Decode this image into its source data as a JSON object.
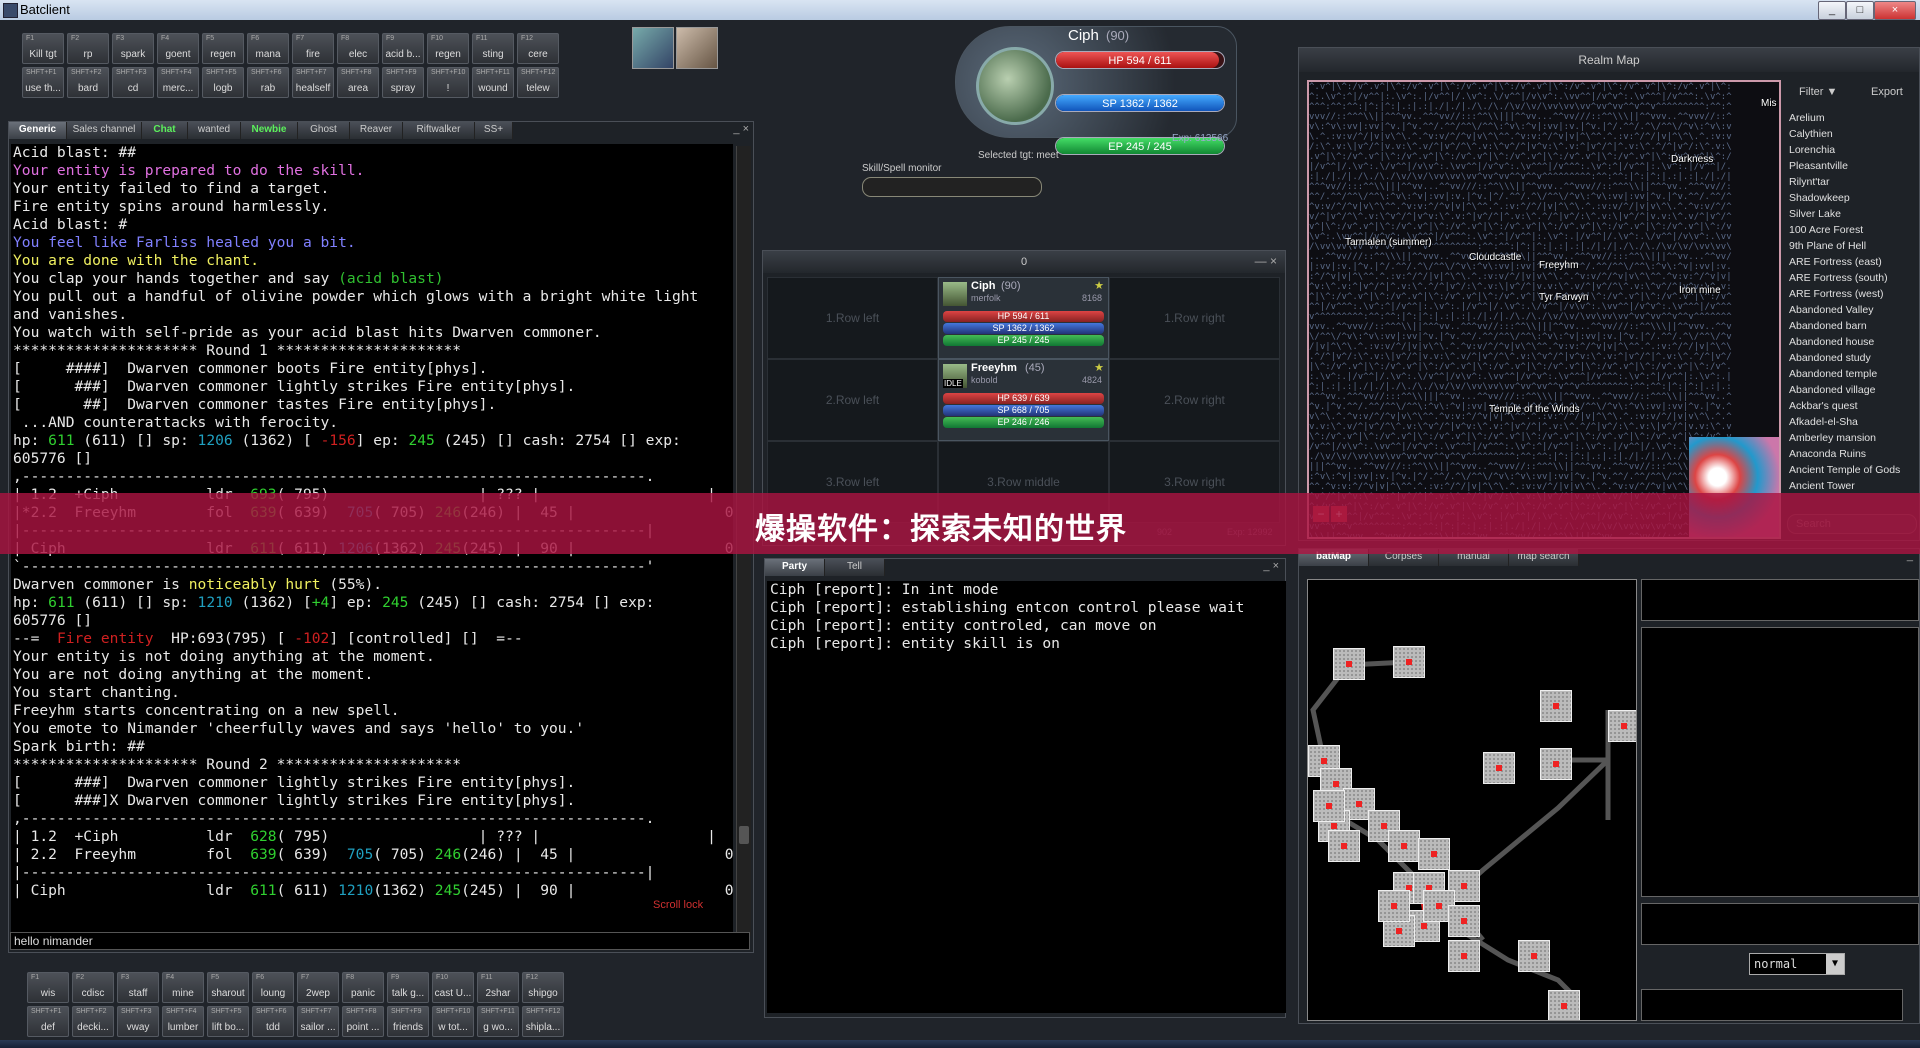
{
  "window": {
    "title": "Batclient",
    "min": "_",
    "max": "□",
    "close": "×"
  },
  "macros_top": [
    {
      "key": "F1",
      "label": "Kill tgt"
    },
    {
      "key": "F2",
      "label": "rp"
    },
    {
      "key": "F3",
      "label": "spark"
    },
    {
      "key": "F4",
      "label": "goent"
    },
    {
      "key": "F5",
      "label": "regen"
    },
    {
      "key": "F6",
      "label": "mana"
    },
    {
      "key": "F7",
      "label": "fire"
    },
    {
      "key": "F8",
      "label": "elec"
    },
    {
      "key": "F9",
      "label": "acid b..."
    },
    {
      "key": "F10",
      "label": "regen"
    },
    {
      "key": "F11",
      "label": "sting"
    },
    {
      "key": "F12",
      "label": "cere"
    },
    {
      "key": "SHFT+F1",
      "label": "use th..."
    },
    {
      "key": "SHFT+F2",
      "label": "bard"
    },
    {
      "key": "SHFT+F3",
      "label": "cd"
    },
    {
      "key": "SHFT+F4",
      "label": "merc..."
    },
    {
      "key": "SHFT+F5",
      "label": "logb"
    },
    {
      "key": "SHFT+F6",
      "label": "rab"
    },
    {
      "key": "SHFT+F7",
      "label": "healself"
    },
    {
      "key": "SHFT+F8",
      "label": "area"
    },
    {
      "key": "SHFT+F9",
      "label": "spray"
    },
    {
      "key": "SHFT+F10",
      "label": "!"
    },
    {
      "key": "SHFT+F11",
      "label": "wound"
    },
    {
      "key": "SHFT+F12",
      "label": "telew"
    }
  ],
  "macros_bottom": [
    {
      "key": "F1",
      "label": "wis"
    },
    {
      "key": "F2",
      "label": "cdisc"
    },
    {
      "key": "F3",
      "label": "staff"
    },
    {
      "key": "F4",
      "label": "mine"
    },
    {
      "key": "F5",
      "label": "sharout"
    },
    {
      "key": "F6",
      "label": "loung"
    },
    {
      "key": "F7",
      "label": "2wep"
    },
    {
      "key": "F8",
      "label": "panic"
    },
    {
      "key": "F9",
      "label": "talk g..."
    },
    {
      "key": "F10",
      "label": "cast U..."
    },
    {
      "key": "F11",
      "label": "2shar"
    },
    {
      "key": "F12",
      "label": "shipgo"
    },
    {
      "key": "SHFT+F1",
      "label": "def"
    },
    {
      "key": "SHFT+F2",
      "label": "decki..."
    },
    {
      "key": "SHFT+F3",
      "label": "vway"
    },
    {
      "key": "SHFT+F4",
      "label": "lumber"
    },
    {
      "key": "SHFT+F5",
      "label": "lift bo..."
    },
    {
      "key": "SHFT+F6",
      "label": "tdd"
    },
    {
      "key": "SHFT+F7",
      "label": "sailor ..."
    },
    {
      "key": "SHFT+F8",
      "label": "point ..."
    },
    {
      "key": "SHFT+F9",
      "label": "friends"
    },
    {
      "key": "SHFT+F10",
      "label": "w tot..."
    },
    {
      "key": "SHFT+F11",
      "label": "g wo..."
    },
    {
      "key": "SHFT+F12",
      "label": "shipla..."
    }
  ],
  "chat_tabs": [
    "Generic",
    "Sales channel",
    "Chat",
    "wanted",
    "Newbie",
    "Ghost",
    "Reaver",
    "Riftwalker",
    "SS+"
  ],
  "output_lines": [
    [
      [
        "Acid blast: ##",
        "#e8e8e8"
      ]
    ],
    [
      [
        "Your entity is prepared to do the skill.",
        "#e070e0"
      ]
    ],
    [
      [
        "Your entity failed to find a target.",
        "#e8e8e8"
      ]
    ],
    [
      [
        "Fire entity spins around harmlessly.",
        "#e8e8e8"
      ]
    ],
    [
      [
        "Acid blast: #",
        "#e8e8e8"
      ]
    ],
    [
      [
        "You feel like Farliss healed you a bit.",
        "#8080ff"
      ]
    ],
    [
      [
        "You are done with the chant.",
        "#f0f060"
      ]
    ],
    [
      [
        "You clap your hands together and say ",
        "#e8e8e8"
      ],
      [
        "(acid blast)",
        "#30c030"
      ]
    ],
    [
      [
        "You pull out a handful of olivine powder which glows with a bright white light",
        "#e8e8e8"
      ]
    ],
    [
      [
        "and vanishes.",
        "#e8e8e8"
      ]
    ],
    [
      [
        "You watch with self-pride as your acid blast hits Dwarven commoner.",
        "#e8e8e8"
      ]
    ],
    [
      [
        "********************* Round 1 *********************",
        "#e8e8e8"
      ]
    ],
    [
      [
        "[     ####]  Dwarven commoner boots Fire entity[phys].",
        "#e8e8e8"
      ]
    ],
    [
      [
        "[      ###]  Dwarven commoner lightly strikes Fire entity[phys].",
        "#e8e8e8"
      ]
    ],
    [
      [
        "[       ##]  Dwarven commoner tastes Fire entity[phys].",
        "#e8e8e8"
      ]
    ],
    [
      [
        " ...AND counterattacks with ferocity.",
        "#e8e8e8"
      ]
    ],
    [
      [
        "hp: ",
        "#e8e8e8"
      ],
      [
        "611",
        "#30d030"
      ],
      [
        " (611) [] sp: ",
        "#e8e8e8"
      ],
      [
        "1206",
        "#20a0c0"
      ],
      [
        " (1362) [ ",
        "#e8e8e8"
      ],
      [
        "-156",
        "#d02020"
      ],
      [
        "] ep: ",
        "#e8e8e8"
      ],
      [
        "245",
        "#30d030"
      ],
      [
        " (245) [] cash: 2754 [] exp:",
        "#e8e8e8"
      ]
    ],
    [
      [
        "605776 []",
        "#e8e8e8"
      ]
    ],
    [
      [
        ",-----------------------------------------------------------------------.",
        "#e8e8e8"
      ]
    ],
    [
      [
        "| 1.2  +Ciph          ldr  ",
        "#e8e8e8"
      ],
      [
        "693",
        "#30d030"
      ],
      [
        "( 795)                 | ??? |                   |",
        "#e8e8e8"
      ]
    ],
    [
      [
        "|*2.2  Freeyhm        fol  ",
        "#e8e8e8"
      ],
      [
        "639",
        "#30d030"
      ],
      [
        "( 639)  ",
        "#e8e8e8"
      ],
      [
        "705",
        "#20a0c0"
      ],
      [
        "( 705) ",
        "#e8e8e8"
      ],
      [
        "246",
        "#30d030"
      ],
      [
        "(246) |  45 |                 0 |",
        "#e8e8e8"
      ]
    ],
    [
      [
        "|-----------------------------------------------------------------------|",
        "#e8e8e8"
      ]
    ],
    [
      [
        "| Ciph                ldr  ",
        "#e8e8e8"
      ],
      [
        "611",
        "#30d030"
      ],
      [
        "( 611) ",
        "#e8e8e8"
      ],
      [
        "1206",
        "#20a0c0"
      ],
      [
        "(1362) ",
        "#e8e8e8"
      ],
      [
        "245",
        "#30d030"
      ],
      [
        "(245) |  90 |                 0 |",
        "#e8e8e8"
      ]
    ],
    [
      [
        "`-----------------------------------------------------------------------'",
        "#e8e8e8"
      ]
    ],
    [
      [
        "Dwarven commoner is ",
        "#e8e8e8"
      ],
      [
        "noticeably hurt",
        "#f0f060"
      ],
      [
        " (55%).",
        "#e8e8e8"
      ]
    ],
    [
      [
        "hp: ",
        "#e8e8e8"
      ],
      [
        "611",
        "#30d030"
      ],
      [
        " (611) [] sp: ",
        "#e8e8e8"
      ],
      [
        "1210",
        "#20a0c0"
      ],
      [
        " (1362) [",
        "#e8e8e8"
      ],
      [
        "+4",
        "#30d030"
      ],
      [
        "] ep: ",
        "#e8e8e8"
      ],
      [
        "245",
        "#30d030"
      ],
      [
        " (245) [] cash: 2754 [] exp:",
        "#e8e8e8"
      ]
    ],
    [
      [
        "605776 []",
        "#e8e8e8"
      ]
    ],
    [
      [
        "--=  ",
        "#e8e8e8"
      ],
      [
        "Fire entity",
        "#d02020"
      ],
      [
        "  HP:693(795) [ ",
        "#e8e8e8"
      ],
      [
        "-102",
        "#d02020"
      ],
      [
        "] [controlled] []  =--",
        "#e8e8e8"
      ]
    ],
    [
      [
        "Your entity is not doing anything at the moment.",
        "#e8e8e8"
      ]
    ],
    [
      [
        "You are not doing anything at the moment.",
        "#e8e8e8"
      ]
    ],
    [
      [
        "You start chanting.",
        "#e8e8e8"
      ]
    ],
    [
      [
        "Freeyhm starts concentrating on a new spell.",
        "#e8e8e8"
      ]
    ],
    [
      [
        "You emote to Nimander 'cheerfully waves and says 'hello' to you.'",
        "#e8e8e8"
      ]
    ],
    [
      [
        "Spark birth: ##",
        "#e8e8e8"
      ]
    ],
    [
      [
        "********************* Round 2 *********************",
        "#e8e8e8"
      ]
    ],
    [
      [
        "[      ###]  Dwarven commoner lightly strikes Fire entity[phys].",
        "#e8e8e8"
      ]
    ],
    [
      [
        "[      ###]X Dwarven commoner lightly strikes Fire entity[phys].",
        "#e8e8e8"
      ]
    ],
    [
      [
        ",-----------------------------------------------------------------------.",
        "#e8e8e8"
      ]
    ],
    [
      [
        "| 1.2  +Ciph          ldr  ",
        "#e8e8e8"
      ],
      [
        "628",
        "#30d030"
      ],
      [
        "( 795)                 | ??? |                   |",
        "#e8e8e8"
      ]
    ],
    [
      [
        "| 2.2  Freeyhm        fol  ",
        "#e8e8e8"
      ],
      [
        "639",
        "#30d030"
      ],
      [
        "( 639)  ",
        "#e8e8e8"
      ],
      [
        "705",
        "#20a0c0"
      ],
      [
        "( 705) ",
        "#e8e8e8"
      ],
      [
        "246",
        "#30d030"
      ],
      [
        "(246) |  45 |                 0 |",
        "#e8e8e8"
      ]
    ],
    [
      [
        "|-----------------------------------------------------------------------|",
        "#e8e8e8"
      ]
    ],
    [
      [
        "| Ciph                ldr  ",
        "#e8e8e8"
      ],
      [
        "611",
        "#30d030"
      ],
      [
        "( 611) ",
        "#e8e8e8"
      ],
      [
        "1210",
        "#20a0c0"
      ],
      [
        "(1362) ",
        "#e8e8e8"
      ],
      [
        "245",
        "#30d030"
      ],
      [
        "(245) |  90 |                 0 |",
        "#e8e8e8"
      ]
    ]
  ],
  "scroll_lock": "Scroll lock",
  "input_value": "hello nimander",
  "player": {
    "name": "Ciph",
    "level": "(90)",
    "hp": "HP  594 / 611",
    "hp_frac": 0.972,
    "sp": "SP  1362 / 1362",
    "sp_frac": 1.0,
    "ep": "EP  245 / 245",
    "ep_frac": 1.0,
    "exp": "Exp: 613566",
    "selected": "Selected tgt: meet",
    "skill_monitor": "Skill/Spell monitor"
  },
  "party": {
    "title": "0",
    "cells": [
      "1.Row left",
      "1.Row right",
      "2.Row left",
      "2.Row right",
      "3.Row left",
      "3.Row middle",
      "3.Row right"
    ],
    "members": [
      {
        "name": "Ciph",
        "level": "(90)",
        "race": "merfolk",
        "num": "8168",
        "hp": "HP 594 / 611",
        "sp": "SP 1362 / 1362",
        "ep": "EP 245 / 245"
      },
      {
        "name": "Freeyhm",
        "level": "(45)",
        "race": "kobold",
        "num": "4824",
        "status": "IDLE",
        "hp": "HP 639 / 639",
        "sp": "SP 668 / 705",
        "ep": "EP 246 / 246"
      }
    ],
    "footer_left": "902",
    "footer_right": "Exp: 12992"
  },
  "party_tabs": [
    "Party",
    "Tell"
  ],
  "party_output": [
    "Ciph [report]: In int mode",
    "Ciph [report]: establishing entcon control please wait",
    "Ciph [report]: entity controled, can move on",
    "Ciph [report]: entity skill is on"
  ],
  "realm_map": {
    "title": "Realm Map",
    "filter": "Filter ▼",
    "export": "Export",
    "labels": [
      "Tarmalen (summer)",
      "Cloudcastle",
      "Freeyhm",
      "Tyr Farwyn",
      "Iron mine",
      "Darkness",
      "Temple of the Winds",
      "Mis"
    ],
    "locations": [
      "Arelium",
      "Calythien",
      "Lorenchia",
      "Pleasantville",
      "Rilynt'tar",
      "Shadowkeep",
      "Silver Lake",
      "100 Acre Forest",
      "9th Plane of Hell",
      "ARE Fortress (east)",
      "ARE Fortress (south)",
      "ARE Fortress (west)",
      "Abandoned Valley",
      "Abandoned barn",
      "Abandoned house",
      "Abandoned study",
      "Abandoned temple",
      "Abandoned village",
      "Ackbar's quest",
      "Afkadel-el-Sha",
      "Amberley mansion",
      "Anaconda Ruins",
      "Ancient Temple of Gods",
      "Ancient Tower"
    ],
    "search": "Search"
  },
  "batmap_tabs": [
    "batMap",
    "Corpses",
    "manual",
    "map search"
  ],
  "batmap_mode": "normal",
  "banner": "爆操软件：探索未知的世界"
}
